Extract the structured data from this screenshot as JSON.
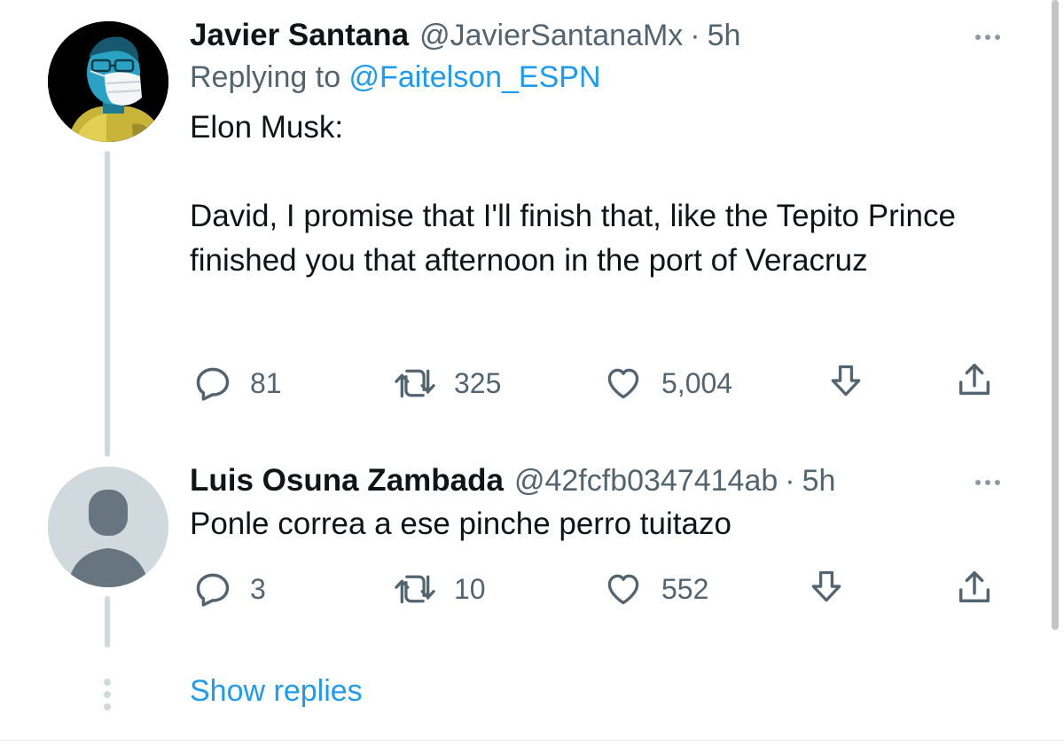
{
  "tweets": [
    {
      "author_name": "Javier Santana",
      "handle": "@JavierSantanaMx",
      "separator": "·",
      "time": "5h",
      "replying_prefix": "Replying to ",
      "replying_to": "@Faitelson_ESPN",
      "text": "Elon Musk:\n\nDavid, I promise that I'll finish that, like the Tepito Prince finished you that afternoon in the port of Veracruz",
      "replies": "81",
      "retweets": "325",
      "likes": "5,004",
      "avatar_icon": "masked-person-avatar"
    },
    {
      "author_name": "Luis Osuna Zambada",
      "handle": "@42fcfb0347414ab",
      "separator": "·",
      "time": "5h",
      "text": "Ponle correa a ese pinche perro tuitazo",
      "replies": "3",
      "retweets": "10",
      "likes": "552",
      "avatar_icon": "default-profile-avatar"
    }
  ],
  "show_replies_label": "Show replies",
  "colors": {
    "link": "#1d9bf0",
    "secondary_text": "#536471",
    "thread_line": "#cfd9de"
  }
}
